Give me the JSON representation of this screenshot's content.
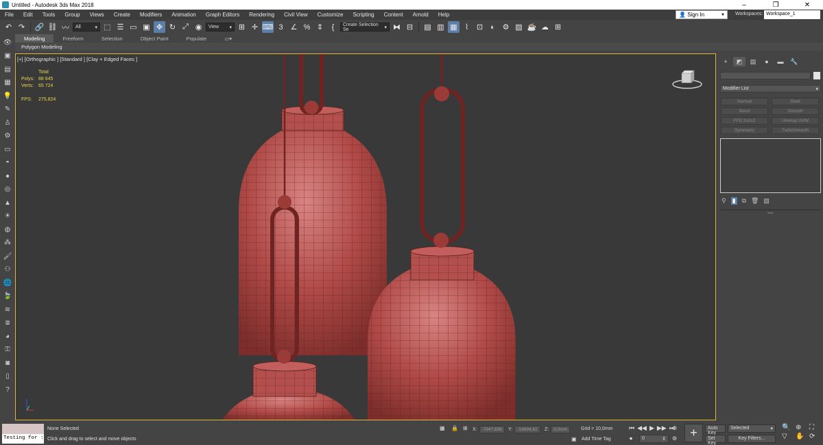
{
  "window": {
    "title": "Untitled - Autodesk 3ds Max 2018",
    "minimize": "–",
    "maximize": "❐",
    "close": "✕"
  },
  "menu": {
    "items": [
      "File",
      "Edit",
      "Tools",
      "Group",
      "Views",
      "Create",
      "Modifiers",
      "Animation",
      "Graph Editors",
      "Rendering",
      "Civil View",
      "Customize",
      "Scripting",
      "Content",
      "Arnold",
      "Help"
    ],
    "sign_in": "Sign In",
    "workspaces_label": "Workspaces:",
    "workspace_value": "Workspace_1"
  },
  "toolbar": {
    "selection_filter": "All",
    "reference_coord": "View",
    "named_selection": "Create Selection Se"
  },
  "ribbon": {
    "tabs": [
      "Modeling",
      "Freeform",
      "Selection",
      "Object Paint",
      "Populate"
    ],
    "active_panel": "Polygon Modeling"
  },
  "viewport": {
    "label": "[+] [Orthographic ] [Standard ] [Clay + Edged Faces ]",
    "stats": {
      "total_label": "Total",
      "polys_label": "Polys:",
      "polys_value": "88 645",
      "verts_label": "Verts:",
      "verts_value": "65 724",
      "fps_label": "FPS:",
      "fps_value": "275,824"
    },
    "mesh_color": "#b04a47",
    "border_color": "#e3b83a"
  },
  "command_panel": {
    "modifier_list": "Modifier List",
    "modifiers": [
      "Normal",
      "Shell",
      "Bend",
      "Smooth",
      "FFD 2x2x2",
      "Unwrap UVW",
      "Symmetry",
      "TurboSmooth"
    ]
  },
  "status": {
    "miniscript_input": "Testing for :",
    "selection": "None Selected",
    "prompt": "Click and drag to select and move objects",
    "x_label": "X:",
    "x_value": "-7947,838",
    "y_label": "Y:",
    "y_value": "-14894,42",
    "z_label": "Z:",
    "z_value": "0,0mm",
    "grid": "Grid = 10,0mm",
    "add_time_tag": "Add Time Tag",
    "frame": "0",
    "auto_key": "Auto Key",
    "set_key": "Set Key",
    "selected": "Selected",
    "key_filters": "Key Filters..."
  }
}
